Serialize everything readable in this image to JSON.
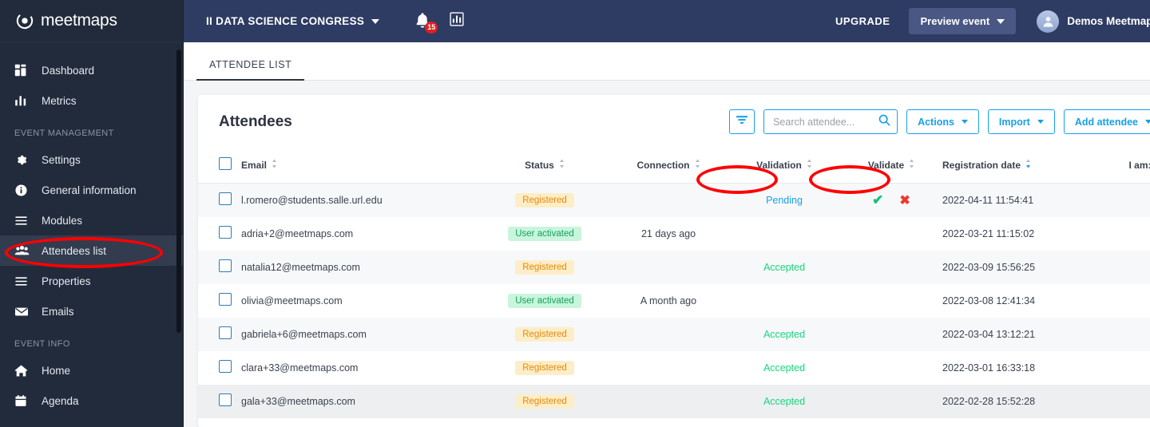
{
  "brand": {
    "name": "meetmaps",
    "logo_icon": "meetmaps-logo-icon"
  },
  "sidebar": {
    "items": [
      {
        "label": "Dashboard",
        "icon": "dashboard-icon",
        "active": false
      },
      {
        "label": "Metrics",
        "icon": "bar-chart-icon",
        "active": false
      }
    ],
    "section_event_management": "EVENT MANAGEMENT",
    "event_management_items": [
      {
        "label": "Settings",
        "icon": "gear-icon",
        "active": false
      },
      {
        "label": "General information",
        "icon": "info-icon",
        "active": false
      },
      {
        "label": "Modules",
        "icon": "menu-lines-icon",
        "active": false
      },
      {
        "label": "Attendees list",
        "icon": "people-group-icon",
        "active": true
      },
      {
        "label": "Properties",
        "icon": "menu-lines-icon",
        "active": false
      },
      {
        "label": "Emails",
        "icon": "envelope-icon",
        "active": false
      }
    ],
    "section_event_info": "EVENT INFO",
    "event_info_items": [
      {
        "label": "Home",
        "icon": "home-icon",
        "active": false
      },
      {
        "label": "Agenda",
        "icon": "calendar-icon",
        "active": false
      }
    ]
  },
  "topbar": {
    "event_name": "II DATA SCIENCE CONGRESS",
    "notification_count": "15",
    "notification_icon": "bell-icon",
    "analytics_icon": "bar-chart-icon",
    "upgrade_label": "UPGRADE",
    "preview_label": "Preview event",
    "user_name": "Demos Meetmaps",
    "avatar_icon": "user-avatar-icon"
  },
  "tabs": [
    {
      "label": "ATTENDEE LIST",
      "active": true
    }
  ],
  "main": {
    "title": "Attendees",
    "filter_icon": "filter-icon",
    "search": {
      "placeholder": "Search attendee...",
      "value": "",
      "icon": "search-icon"
    },
    "buttons": [
      {
        "label": "Actions",
        "name": "actions-button"
      },
      {
        "label": "Import",
        "name": "import-button"
      },
      {
        "label": "Add attendee",
        "name": "add-attendee-button"
      }
    ]
  },
  "table": {
    "columns": [
      {
        "label": "",
        "key": "checkbox",
        "sortable": false
      },
      {
        "label": "Email",
        "key": "email",
        "sortable": true,
        "sort": "none"
      },
      {
        "label": "Status",
        "key": "status",
        "sortable": true,
        "sort": "none"
      },
      {
        "label": "Connection",
        "key": "connection",
        "sortable": true,
        "sort": "none"
      },
      {
        "label": "Validation",
        "key": "validation",
        "sortable": true,
        "sort": "none",
        "highlighted": true
      },
      {
        "label": "Validate",
        "key": "validate",
        "sortable": true,
        "sort": "none",
        "highlighted": true
      },
      {
        "label": "Registration date",
        "key": "registration_date",
        "sortable": true,
        "sort": "desc"
      },
      {
        "label": "I am:",
        "key": "i_am",
        "sortable": true,
        "sort": "none"
      }
    ],
    "rows": [
      {
        "email": "l.romero@students.salle.url.edu",
        "status": "Registered",
        "status_type": "registered",
        "connection": "",
        "validation": "Pending",
        "validation_type": "pending",
        "has_validate_actions": true,
        "registration_date": "2022-04-11 11:54:41",
        "i_am": ""
      },
      {
        "email": "adria+2@meetmaps.com",
        "status": "User activated",
        "status_type": "activated",
        "connection": "21 days ago",
        "validation": "",
        "validation_type": "",
        "has_validate_actions": false,
        "registration_date": "2022-03-21 11:15:02",
        "i_am": ""
      },
      {
        "email": "natalia12@meetmaps.com",
        "status": "Registered",
        "status_type": "registered",
        "connection": "",
        "validation": "Accepted",
        "validation_type": "accepted",
        "has_validate_actions": false,
        "registration_date": "2022-03-09 15:56:25",
        "i_am": ""
      },
      {
        "email": "olivia@meetmaps.com",
        "status": "User activated",
        "status_type": "activated",
        "connection": "A month ago",
        "validation": "",
        "validation_type": "",
        "has_validate_actions": false,
        "registration_date": "2022-03-08 12:41:34",
        "i_am": ""
      },
      {
        "email": "gabriela+6@meetmaps.com",
        "status": "Registered",
        "status_type": "registered",
        "connection": "",
        "validation": "Accepted",
        "validation_type": "accepted",
        "has_validate_actions": false,
        "registration_date": "2022-03-04 13:12:21",
        "i_am": ""
      },
      {
        "email": "clara+33@meetmaps.com",
        "status": "Registered",
        "status_type": "registered",
        "connection": "",
        "validation": "Accepted",
        "validation_type": "accepted",
        "has_validate_actions": false,
        "registration_date": "2022-03-01 16:33:18",
        "i_am": ""
      },
      {
        "email": "gala+33@meetmaps.com",
        "status": "Registered",
        "status_type": "registered",
        "connection": "",
        "validation": "Accepted",
        "validation_type": "accepted",
        "has_validate_actions": false,
        "registration_date": "2022-02-28 15:52:28",
        "i_am": ""
      }
    ],
    "validate_accept_icon": "check-icon",
    "validate_reject_icon": "x-icon"
  },
  "annotations": {
    "color": "#ff0000",
    "ovals": [
      {
        "target": "sidebar-item-attendees-list"
      },
      {
        "target": "column-header-validation"
      },
      {
        "target": "column-header-validate"
      }
    ]
  },
  "colors": {
    "sidebar_bg": "#222b3c",
    "topbar_bg": "#2e3b63",
    "accent_blue": "#18a0e8",
    "registered_pill_bg": "#fdeec8",
    "registered_pill_fg": "#e8880c",
    "activated_pill_bg": "#c9f5dd",
    "activated_pill_fg": "#16a05d",
    "accepted_text": "#16d87d",
    "pending_text": "#18a0e8",
    "annotation_red": "#ff0000"
  }
}
